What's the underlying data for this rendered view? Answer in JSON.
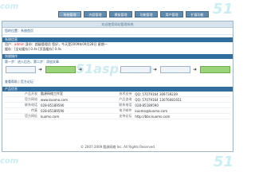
{
  "watermarks": {
    "top_left": "com",
    "top_right": "51",
    "bottom_left": "com",
    "bottom_right": "51",
    "flow": "51asp.com"
  },
  "nav": {
    "tabs": [
      {
        "label": "系统管理"
      },
      {
        "label": "内容管理"
      },
      {
        "label": "模板管理"
      },
      {
        "label": "功能管理"
      },
      {
        "label": "用户管理"
      },
      {
        "label": "扩展功能"
      }
    ]
  },
  "main": {
    "title": "欢迎使用网站管理系统",
    "breadcrumb": "您的位置：系统首页",
    "section1": "系统信息",
    "user_line_prefix": "用户：",
    "user_line_user": "admin",
    "user_line_rest": "身份：超级管理员  您好，今天是2009年09月28日 星期一",
    "cache_line": "缓存：[全站缓存] 0.4s   [页面缓存] 0.4s",
    "section2": "快捷操作",
    "flow_label": "第一步：进入后台，第二步：添加文章",
    "links": "查看帮助  |  官方论坛",
    "section3": "产品信息"
  },
  "info_table": [
    {
      "k1": "产品开发",
      "v1": "酷源网络工作室",
      "k2": "技术支持",
      "v2": "QQ: 57079164 309739239"
    },
    {
      "k1": "官方网站",
      "v1": "www.kuomo.com",
      "k2": "产品咨询",
      "v2": "QQ: 57079164 13076081651"
    },
    {
      "k1": "联系电话",
      "v1": "028-85189590",
      "k2": "联系电话",
      "v2": "028-85189590"
    },
    {
      "k1": "传真",
      "v1": "028-85189590",
      "k2": "电子邮件",
      "v2": "kuomo@kuomo.com"
    },
    {
      "k1": "官方网址",
      "v1": "kuomo.com",
      "k2": "支持论坛",
      "v2": "http://bbs.kuomo.com"
    }
  ],
  "footer": "© 2007-2009 酷源网络 Inc. All Rights Reserved"
}
